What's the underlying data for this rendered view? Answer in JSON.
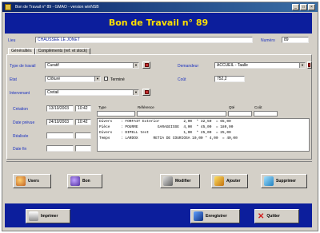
{
  "window": {
    "title": "Bon de Travail n° 89 - GMAO - version winNSB"
  },
  "banner": {
    "title": "Bon de Travail n° 89"
  },
  "header": {
    "lieu_label": "Lieu",
    "lieu_value": "CHAUSSEE LE JONET",
    "numero_label": "Numéro",
    "numero_value": "89"
  },
  "tabs": [
    {
      "label": "Généralités"
    },
    {
      "label": "Compléments (ref. et stock)"
    }
  ],
  "form": {
    "type_label": "Type de travail",
    "type_value": "Curatif",
    "demandeur_label": "Demandeur",
    "demandeur_value": "ACCUEIL - Taalle",
    "etat_label": "Etat",
    "etat_value": "Clôturé",
    "termine_label": "Terminé",
    "cout_label": "Coût",
    "cout_value": "752,2",
    "intervenant_label": "Intervenant",
    "intervenant_value": "Cretail"
  },
  "dates": {
    "creation_label": "Création",
    "creation_date": "13/10/2003",
    "creation_time": "10:42",
    "prevue_label": "Date prévue",
    "prevue_date": "24/10/2003",
    "prevue_time": "10:42",
    "realisee_label": "Réalisée",
    "fin_label": "Date fin"
  },
  "grid": {
    "columns": [
      "Type",
      "Référence",
      "Qté",
      "Coût"
    ],
    "rows": [
      "Divers    : FORFAIT Exterior           2,00  * 32,50  = 65,00",
      "Pièce     : POURRE         GARAGEISSE  4,00  * 45,00  = 180,00",
      "Divers    : DIPELL test                1,00  * 25,00  = 25,00",
      "Temps     : LARDOX       RETIA DE COURIOSA 10,00 * 4,00  = 40,00"
    ]
  },
  "buttons": {
    "users": "Users",
    "bon": "Bon",
    "modifier": "Modifier",
    "ajouter": "Ajouter",
    "supprimer": "Supprimer",
    "imprimer": "Imprimer",
    "enregistrer": "Enregistrer",
    "quitter": "Quitter"
  },
  "colors": {
    "banner_bg": "#0c1e9c",
    "banner_text": "#ffe000",
    "label": "#1a30c0"
  }
}
